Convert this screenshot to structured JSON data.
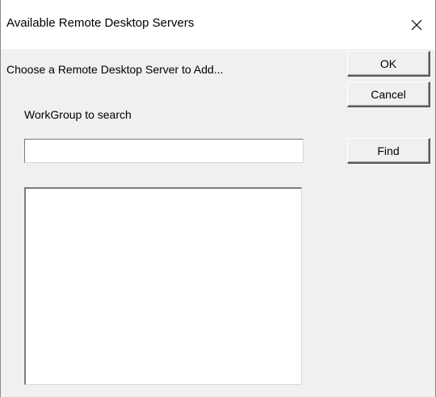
{
  "window": {
    "title": "Available Remote Desktop Servers",
    "close_icon": "close-icon"
  },
  "dialog": {
    "prompt": "Choose a Remote Desktop Server to Add...",
    "workgroup_label": "WorkGroup to search",
    "workgroup_value": "",
    "server_list": []
  },
  "buttons": {
    "ok": "OK",
    "cancel": "Cancel",
    "find": "Find"
  },
  "colors": {
    "titlebar_bg": "#ffffff",
    "dialog_bg": "#f0f0f0",
    "field_bg": "#ffffff"
  }
}
